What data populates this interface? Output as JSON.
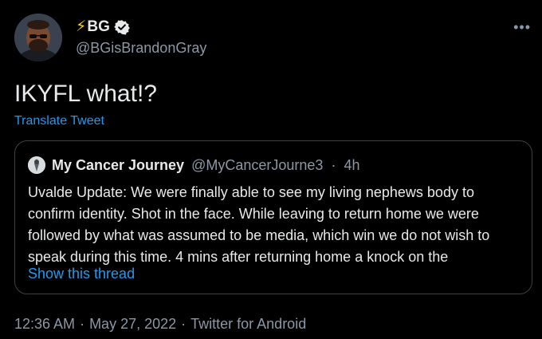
{
  "author": {
    "emoji": "⚡",
    "display_name": "BG",
    "handle": "@BGisBrandonGray",
    "verified": true
  },
  "tweet": {
    "text": "IKYFL what!?",
    "translate_label": "Translate Tweet"
  },
  "quoted": {
    "display_name": "My Cancer Journey",
    "handle": "@MyCancerJourne3",
    "separator": "·",
    "time": "4h",
    "lines": [
      "Uvalde Update: We were finally able to see my living nephews body to",
      "confirm identity. Shot in the face. While leaving to return home we were",
      "followed by what was assumed to be media, which win we do not wish to",
      "speak during this time. 4 mins after returning home a knock on the"
    ],
    "show_thread_label": "Show this thread"
  },
  "meta": {
    "time": "12:36 AM",
    "date": "May 27, 2022",
    "source": "Twitter for Android",
    "separator": "·"
  },
  "icons": {
    "more": "more-horizontal-icon",
    "verified": "verified-badge-icon"
  },
  "colors": {
    "background": "#000000",
    "text": "#e7e9ea",
    "secondary": "#8b98a5",
    "link": "#1d9bf0",
    "border": "#3e4144",
    "bolt": "#ffd400"
  }
}
